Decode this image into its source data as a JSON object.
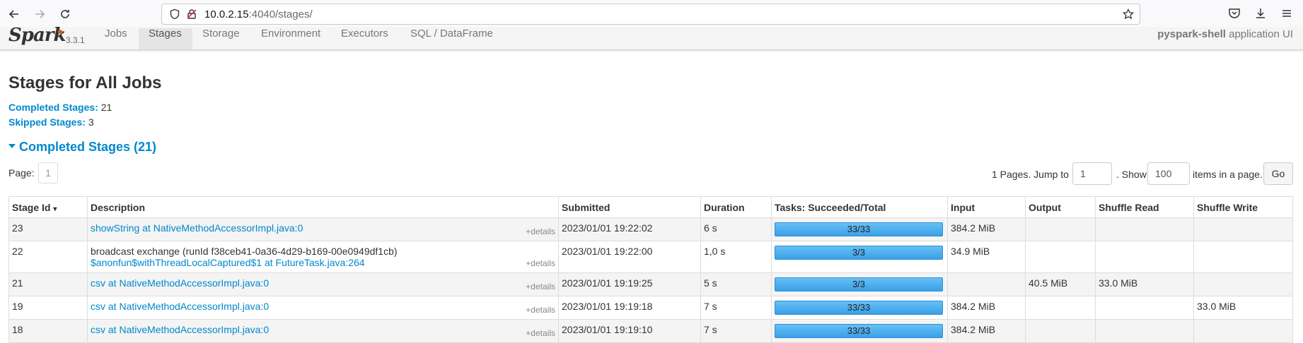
{
  "browser": {
    "url_host": "10.0.2.15",
    "url_rest": ":4040/stages/"
  },
  "spark": {
    "brand": "Spark",
    "version": "3.3.1",
    "tabs": [
      "Jobs",
      "Stages",
      "Storage",
      "Environment",
      "Executors",
      "SQL / DataFrame"
    ],
    "active_tab": "Stages",
    "app_name": "pyspark-shell",
    "app_suffix": "application UI"
  },
  "page": {
    "title": "Stages for All Jobs",
    "completed_label": "Completed Stages:",
    "completed_count": "21",
    "skipped_label": "Skipped Stages:",
    "skipped_count": "3",
    "section_title": "Completed Stages (21)"
  },
  "pager": {
    "page_label": "Page:",
    "page_number": "1",
    "pages_jump_label": "1 Pages. Jump to",
    "jump_value": "1",
    "show_label": ". Show",
    "show_value": "100",
    "items_label": "items in a page.",
    "go_label": "Go"
  },
  "table": {
    "headers": {
      "stage_id": "Stage Id",
      "sort_indicator": "▾",
      "description": "Description",
      "submitted": "Submitted",
      "duration": "Duration",
      "tasks": "Tasks: Succeeded/Total",
      "input": "Input",
      "output": "Output",
      "shuffle_read": "Shuffle Read",
      "shuffle_write": "Shuffle Write"
    },
    "details_label": "+details",
    "rows": [
      {
        "id": "23",
        "desc_text": "",
        "desc_link": "showString at NativeMethodAccessorImpl.java:0",
        "submitted": "2023/01/01 19:22:02",
        "duration": "6 s",
        "tasks": "33/33",
        "progress": 1.0,
        "input": "384.2 MiB",
        "output": "",
        "shuffle_read": "",
        "shuffle_write": ""
      },
      {
        "id": "22",
        "desc_text": "broadcast exchange (runId f38ceb41-0a36-4d29-b169-00e0949df1cb)",
        "desc_link": "$anonfun$withThreadLocalCaptured$1 at FutureTask.java:264",
        "submitted": "2023/01/01 19:22:00",
        "duration": "1,0 s",
        "tasks": "3/3",
        "progress": 1.0,
        "input": "34.9 MiB",
        "output": "",
        "shuffle_read": "",
        "shuffle_write": ""
      },
      {
        "id": "21",
        "desc_text": "",
        "desc_link": "csv at NativeMethodAccessorImpl.java:0",
        "submitted": "2023/01/01 19:19:25",
        "duration": "5 s",
        "tasks": "3/3",
        "progress": 1.0,
        "input": "",
        "output": "40.5 MiB",
        "shuffle_read": "33.0 MiB",
        "shuffle_write": ""
      },
      {
        "id": "19",
        "desc_text": "",
        "desc_link": "csv at NativeMethodAccessorImpl.java:0",
        "submitted": "2023/01/01 19:19:18",
        "duration": "7 s",
        "tasks": "33/33",
        "progress": 1.0,
        "input": "384.2 MiB",
        "output": "",
        "shuffle_read": "",
        "shuffle_write": "33.0 MiB"
      },
      {
        "id": "18",
        "desc_text": "",
        "desc_link": "csv at NativeMethodAccessorImpl.java:0",
        "submitted": "2023/01/01 19:19:10",
        "duration": "7 s",
        "tasks": "33/33",
        "progress": 1.0,
        "input": "384.2 MiB",
        "output": "",
        "shuffle_read": "",
        "shuffle_write": ""
      }
    ]
  },
  "colors": {
    "link": "#0088cc",
    "progress": "#3aa0e8",
    "spark_orange": "#e25a1c"
  }
}
